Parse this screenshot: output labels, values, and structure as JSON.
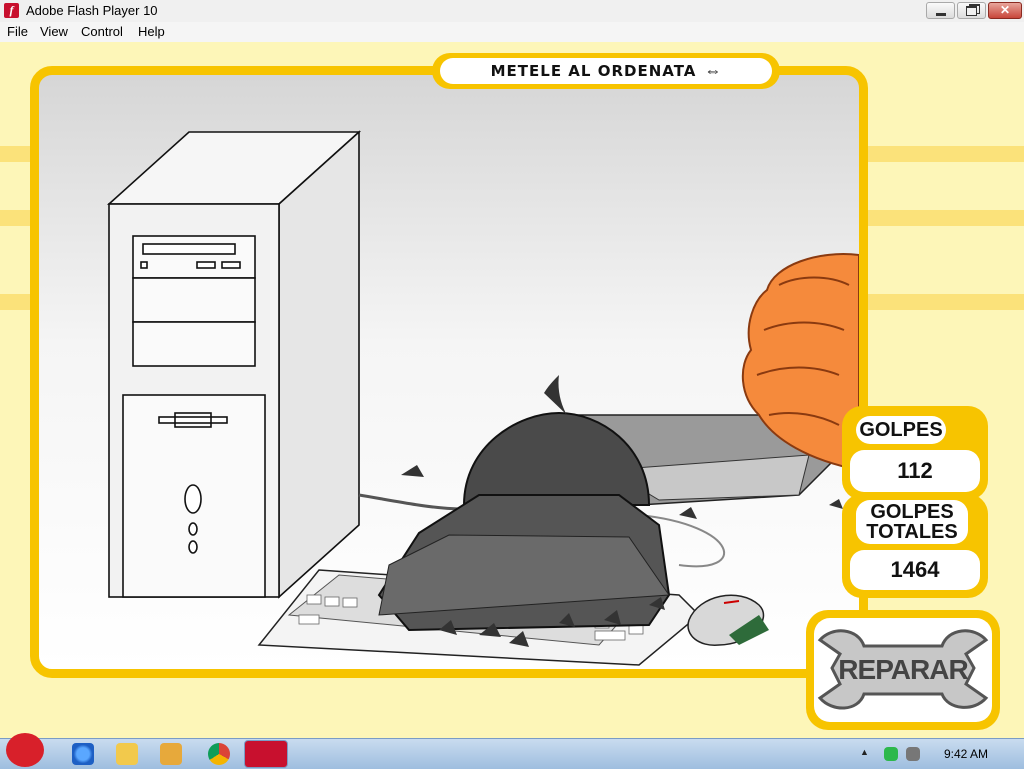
{
  "window": {
    "title": "Adobe Flash Player 10",
    "close_glyph": "✕"
  },
  "menu": {
    "items": [
      "File",
      "View",
      "Control",
      "Help"
    ]
  },
  "game": {
    "title": "METELE AL ORDENATA",
    "back_icon": "⇔",
    "hits_label": "GOLPES",
    "hits_value": "112",
    "total_label_line1": "GOLPES",
    "total_label_line2": "TOTALES",
    "total_value": "1464",
    "repair_label": "REPARAR"
  },
  "taskbar": {
    "clock": "9:42 AM",
    "tray_arrow": "▲"
  },
  "colors": {
    "accent_yellow": "#f7c400",
    "background": "#fdf6b8",
    "flash_red": "#c8102e"
  }
}
